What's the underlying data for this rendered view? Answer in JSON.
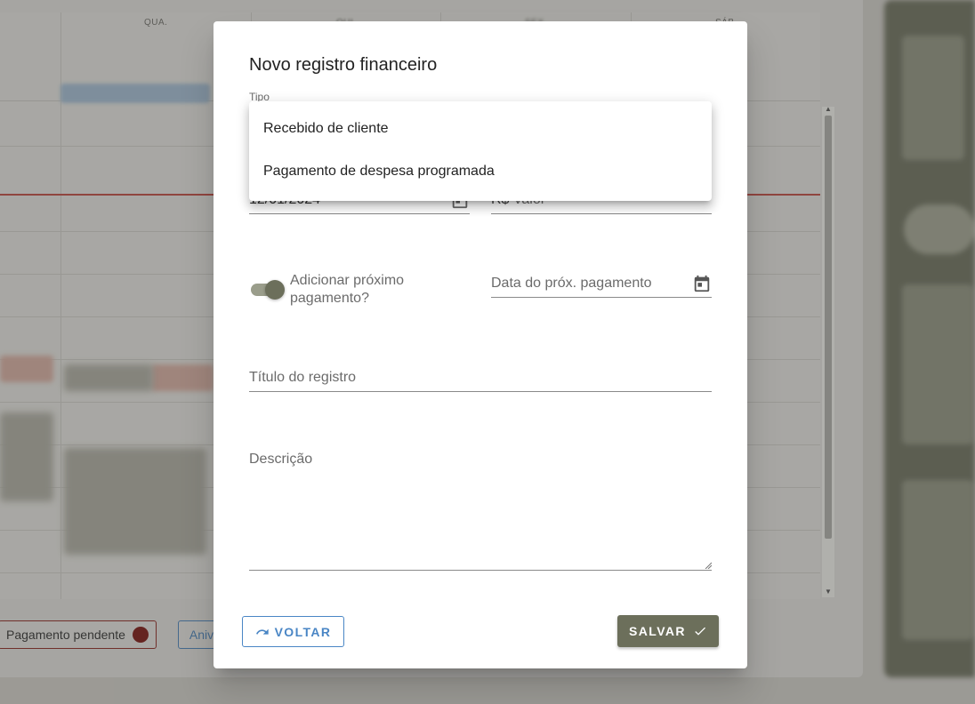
{
  "background": {
    "calendar_day_headers": [
      "QUA.",
      "QUI.",
      "SEX.",
      "SÁB."
    ],
    "legend": {
      "pending_label": "Pagamento pendente",
      "second_label": "Aniv"
    }
  },
  "dialog": {
    "title": "Novo registro financeiro",
    "type_field": {
      "label": "Tipo",
      "options": [
        "Recebido de cliente",
        "Pagamento de despesa programada"
      ]
    },
    "date_field": {
      "value": "12/01/2024",
      "icon": "calendar-icon"
    },
    "value_field": {
      "prefix": "R$",
      "placeholder": "Valor"
    },
    "next_payment_toggle": {
      "label": "Adicionar próximo pagamento?",
      "checked": true
    },
    "next_payment_date": {
      "placeholder": "Data do próx. pagamento",
      "icon": "calendar-icon"
    },
    "title_field": {
      "placeholder": "Título do registro"
    },
    "description_field": {
      "placeholder": "Descrição"
    },
    "buttons": {
      "back_label": "VOLTAR",
      "back_icon": "undo-icon",
      "save_label": "SALVAR",
      "save_icon": "check-icon"
    }
  },
  "colors": {
    "accent_olive": "#6c6f5b",
    "button_blue": "#4a86c5",
    "pending_red": "#7a1a16"
  }
}
